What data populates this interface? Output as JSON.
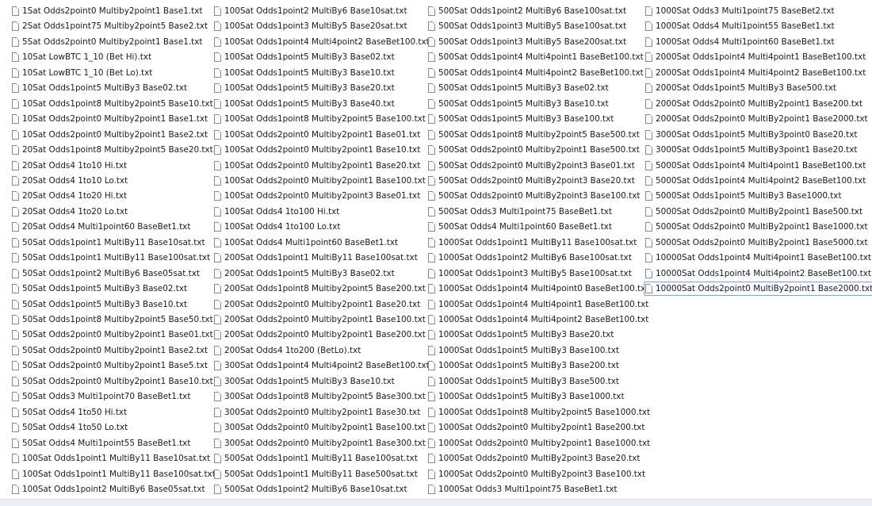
{
  "columns": [
    {
      "files": [
        {
          "name": "1Sat Odds2point0 Multiby2point1 Base1.txt"
        },
        {
          "name": "2Sat Odds1point75 Multiby2point5 Base2.txt"
        },
        {
          "name": "5Sat Odds2point0 Multiby2point1 Base1.txt"
        },
        {
          "name": "10Sat LowBTC 1_10 (Bet Hi).txt"
        },
        {
          "name": "10Sat LowBTC 1_10 (Bet Lo).txt"
        },
        {
          "name": "10Sat Odds1point5 MultiBy3 Base02.txt"
        },
        {
          "name": "10Sat Odds1point8 Multiby2point5 Base10.txt"
        },
        {
          "name": "10Sat Odds2point0 Multiby2point1 Base1.txt"
        },
        {
          "name": "10Sat Odds2point0 Multiby2point1 Base2.txt"
        },
        {
          "name": "20Sat Odds1point8 Multiby2point5 Base20.txt"
        },
        {
          "name": "20Sat Odds4 1to10 Hi.txt"
        },
        {
          "name": "20Sat Odds4 1to10 Lo.txt"
        },
        {
          "name": "20Sat Odds4 1to20 Hi.txt"
        },
        {
          "name": "20Sat Odds4 1to20 Lo.txt"
        },
        {
          "name": "20Sat Odds4 Multi1point60 BaseBet1.txt"
        },
        {
          "name": "50Sat Odds1point1 MultiBy11 Base10sat.txt"
        },
        {
          "name": "50Sat Odds1point1 MultiBy11 Base100sat.txt"
        },
        {
          "name": "50Sat Odds1point2 MultiBy6 Base05sat.txt"
        },
        {
          "name": "50Sat Odds1point5 MultiBy3 Base02.txt"
        },
        {
          "name": "50Sat Odds1point5 MultiBy3 Base10.txt"
        },
        {
          "name": "50Sat Odds1point8 Multiby2point5 Base50.txt"
        },
        {
          "name": "50Sat Odds2point0 Multiby2point1 Base01.txt"
        },
        {
          "name": "50Sat Odds2point0 Multiby2point1 Base2.txt"
        },
        {
          "name": "50Sat Odds2point0 Multiby2point1 Base5.txt"
        },
        {
          "name": "50Sat Odds2point0 Multiby2point1 Base10.txt"
        },
        {
          "name": "50Sat Odds3 Multi1point70 BaseBet1.txt"
        },
        {
          "name": "50Sat Odds4 1to50 Hi.txt"
        },
        {
          "name": "50Sat Odds4 1to50 Lo.txt"
        },
        {
          "name": "50Sat Odds4 Multi1point55 BaseBet1.txt"
        },
        {
          "name": "100Sat Odds1point1 MultiBy11 Base10sat.txt"
        },
        {
          "name": "100Sat Odds1point1 MultiBy11 Base100sat.txt"
        },
        {
          "name": "100Sat Odds1point2 MultiBy6 Base05sat.txt"
        }
      ]
    },
    {
      "files": [
        {
          "name": "100Sat Odds1point2 MultiBy6 Base10sat.txt"
        },
        {
          "name": "100Sat Odds1point3 MultiBy5 Base20sat.txt"
        },
        {
          "name": "100Sat Odds1point4 Multi4point2 BaseBet100.txt"
        },
        {
          "name": "100Sat Odds1point5 MultiBy3 Base02.txt"
        },
        {
          "name": "100Sat Odds1point5 MultiBy3 Base10.txt"
        },
        {
          "name": "100Sat Odds1point5 MultiBy3 Base20.txt"
        },
        {
          "name": "100Sat Odds1point5 MultiBy3 Base40.txt"
        },
        {
          "name": "100Sat Odds1point8 Multiby2point5 Base100.txt"
        },
        {
          "name": "100Sat Odds2point0 Multiby2point1 Base01.txt"
        },
        {
          "name": "100Sat Odds2point0 Multiby2point1 Base10.txt"
        },
        {
          "name": "100Sat Odds2point0 Multiby2point1 Base20.txt"
        },
        {
          "name": "100Sat Odds2point0 Multiby2point1 Base100.txt"
        },
        {
          "name": "100Sat Odds2point0 Multiby2point3 Base01.txt"
        },
        {
          "name": "100Sat Odds4 1to100 Hi.txt"
        },
        {
          "name": "100Sat Odds4 1to100 Lo.txt"
        },
        {
          "name": "100Sat Odds4 Multi1point60 BaseBet1.txt"
        },
        {
          "name": "200Sat Odds1point1 MultiBy11 Base100sat.txt"
        },
        {
          "name": "200Sat Odds1point5 MultiBy3 Base02.txt"
        },
        {
          "name": "200Sat Odds1point8 Multiby2point5 Base200.txt"
        },
        {
          "name": "200Sat Odds2point0 Multiby2point1 Base20.txt"
        },
        {
          "name": "200Sat Odds2point0 Multiby2point1 Base100.txt"
        },
        {
          "name": "200Sat Odds2point0 Multiby2point1 Base200.txt"
        },
        {
          "name": "200Sat Odds4 1to200 (BetLo).txt"
        },
        {
          "name": "300Sat Odds1point4 Multi4point2 BaseBet100.txt"
        },
        {
          "name": "300Sat Odds1point5 MultiBy3 Base10.txt"
        },
        {
          "name": "300Sat Odds1point8 Multiby2point5 Base300.txt"
        },
        {
          "name": "300Sat Odds2point0 Multiby2point1 Base30.txt"
        },
        {
          "name": "300Sat Odds2point0 Multiby2point1 Base100.txt"
        },
        {
          "name": "300Sat Odds2point0 Multiby2point1 Base300.txt"
        },
        {
          "name": "500Sat Odds1point1 MultiBy11 Base100sat.txt"
        },
        {
          "name": "500Sat Odds1point1 MultiBy11 Base500sat.txt"
        },
        {
          "name": "500Sat Odds1point2 MultiBy6 Base10sat.txt"
        }
      ]
    },
    {
      "files": [
        {
          "name": "500Sat Odds1point2 MultiBy6 Base100sat.txt"
        },
        {
          "name": "500Sat Odds1point3 MultiBy5 Base100sat.txt"
        },
        {
          "name": "500Sat Odds1point3 MultiBy5 Base200sat.txt"
        },
        {
          "name": "500Sat Odds1point4 Multi4point1 BaseBet100.txt"
        },
        {
          "name": "500Sat Odds1point4 Multi4point2 BaseBet100.txt"
        },
        {
          "name": "500Sat Odds1point5 MultiBy3 Base02.txt"
        },
        {
          "name": "500Sat Odds1point5 MultiBy3 Base10.txt"
        },
        {
          "name": "500Sat Odds1point5 MultiBy3 Base100.txt"
        },
        {
          "name": "500Sat Odds1point8 Multiby2point5 Base500.txt"
        },
        {
          "name": "500Sat Odds2point0 Multiby2point1 Base500.txt"
        },
        {
          "name": "500Sat Odds2point0 MultiBy2point3 Base01.txt"
        },
        {
          "name": "500Sat Odds2point0 MultiBy2point3 Base20.txt"
        },
        {
          "name": "500Sat Odds2point0 MultiBy2point3 Base100.txt"
        },
        {
          "name": "500Sat Odds3 Multi1point75 BaseBet1.txt"
        },
        {
          "name": "500Sat Odds4 Multi1point60 BaseBet1.txt"
        },
        {
          "name": "1000Sat Odds1point1 MultiBy11 Base100sat.txt"
        },
        {
          "name": "1000Sat Odds1point2 MultiBy6 Base100sat.txt"
        },
        {
          "name": "1000Sat Odds1point3 MultiBy5 Base100sat.txt"
        },
        {
          "name": "1000Sat Odds1point4 Multi4point0 BaseBet100.txt"
        },
        {
          "name": "1000Sat Odds1point4 Multi4point1 BaseBet100.txt"
        },
        {
          "name": "1000Sat Odds1point4 Multi4point2 BaseBet100.txt"
        },
        {
          "name": "1000Sat Odds1point5 MultiBy3 Base20.txt"
        },
        {
          "name": "1000Sat Odds1point5 MultiBy3 Base100.txt"
        },
        {
          "name": "1000Sat Odds1point5 MultiBy3 Base200.txt"
        },
        {
          "name": "1000Sat Odds1point5 MultiBy3 Base500.txt"
        },
        {
          "name": "1000Sat Odds1point5 MultiBy3 Base1000.txt"
        },
        {
          "name": "1000Sat Odds1point8 Multiby2point5 Base1000.txt"
        },
        {
          "name": "1000Sat Odds2point0 Multiby2point1 Base200.txt"
        },
        {
          "name": "1000Sat Odds2point0 Multiby2point1 Base1000.txt"
        },
        {
          "name": "1000Sat Odds2point0 MultiBy2point3 Base20.txt"
        },
        {
          "name": "1000Sat Odds2point0 MultiBy2point3 Base100.txt"
        },
        {
          "name": "1000Sat Odds3 Multi1point75 BaseBet1.txt"
        }
      ]
    },
    {
      "files": [
        {
          "name": "1000Sat Odds3 Multi1point75 BaseBet2.txt"
        },
        {
          "name": "1000Sat Odds4 Multi1point55 BaseBet1.txt"
        },
        {
          "name": "1000Sat Odds4 Multi1point60 BaseBet1.txt"
        },
        {
          "name": "2000Sat Odds1point4 Multi4point1 BaseBet100.txt"
        },
        {
          "name": "2000Sat Odds1point4 Multi4point2 BaseBet100.txt"
        },
        {
          "name": "2000Sat Odds1point5 MultiBy3 Base500.txt"
        },
        {
          "name": "2000Sat Odds2point0 MultiBy2point1 Base200.txt"
        },
        {
          "name": "2000Sat Odds2point0 MultiBy2point1 Base2000.txt"
        },
        {
          "name": "3000Sat Odds1point5 MultiBy3point0 Base20.txt"
        },
        {
          "name": "3000Sat Odds1point5 MultiBy3point1 Base20.txt"
        },
        {
          "name": "5000Sat Odds1point4 Multi4point1 BaseBet100.txt"
        },
        {
          "name": "5000Sat Odds1point4 Multi4point2 BaseBet100.txt"
        },
        {
          "name": "5000Sat Odds1point5 MultiBy3 Base1000.txt"
        },
        {
          "name": "5000Sat Odds2point0 MultiBy2point1 Base500.txt"
        },
        {
          "name": "5000Sat Odds2point0 MultiBy2point1 Base1000.txt"
        },
        {
          "name": "5000Sat Odds2point0 MultiBy2point1 Base5000.txt"
        },
        {
          "name": "10000Sat Odds1point4 Multi4point1 BaseBet100.txt"
        },
        {
          "name": "10000Sat Odds1point4 Multi4point2 BaseBet100.txt"
        },
        {
          "name": "10000Sat Odds2point0 MultiBy2point1 Base2000.txt",
          "selected": true
        }
      ]
    }
  ]
}
